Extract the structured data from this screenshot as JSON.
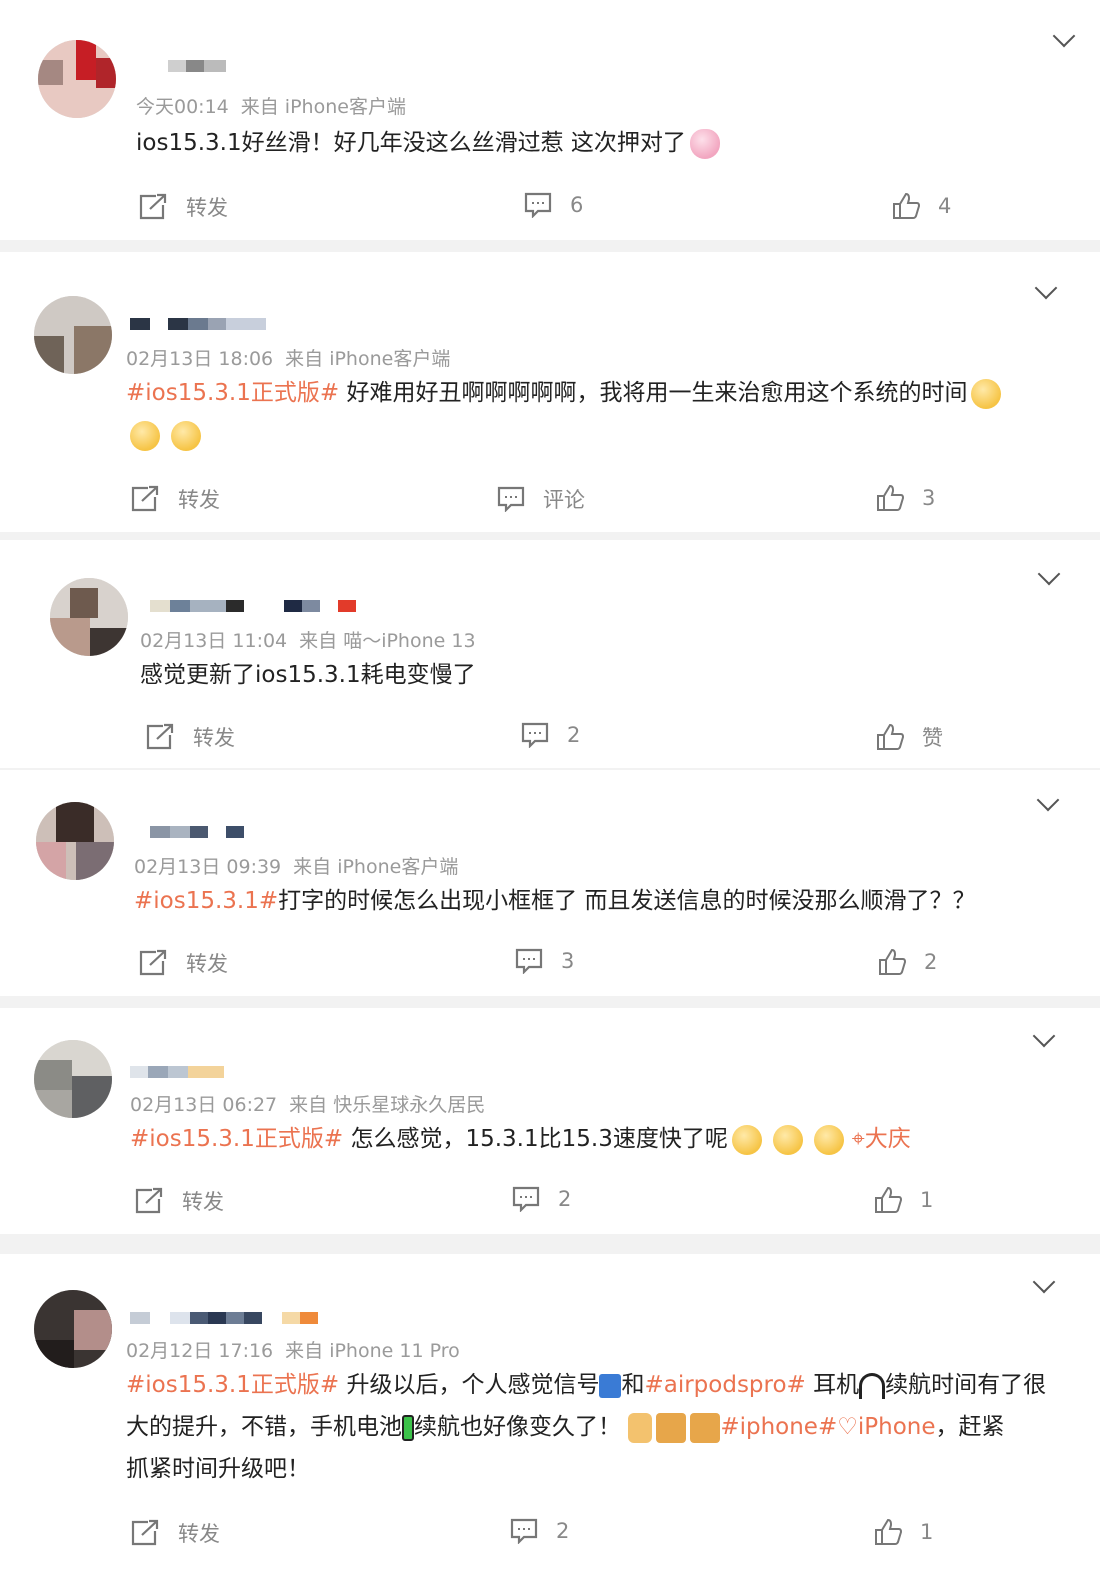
{
  "actions": {
    "repost": "转发",
    "comment": "评论",
    "like": "赞"
  },
  "posts": [
    {
      "time": "今天00:14",
      "source": "来自 iPhone客户端",
      "text": "ios15.3.1好丝滑！好几年没这么丝滑过惹 这次押对了",
      "comments": "6",
      "likes": "4"
    },
    {
      "time": "02月13日 18:06",
      "source": "来自 iPhone客户端",
      "topic": "#ios15.3.1正式版#",
      "text": " 好难用好丑啊啊啊啊啊，我将用一生来治愈用这个系统的时间",
      "comments": "评论",
      "likes": "3"
    },
    {
      "time": "02月13日 11:04",
      "source": "来自 喵～iPhone 13",
      "text": "感觉更新了ios15.3.1耗电变慢了",
      "comments": "2",
      "likes": "赞"
    },
    {
      "time": "02月13日 09:39",
      "source": "来自 iPhone客户端",
      "topic": "#ios15.3.1#",
      "text": "打字的时候怎么出现小框框了 而且发送信息的时候没那么顺滑了？？",
      "comments": "3",
      "likes": "2"
    },
    {
      "time": "02月13日 06:27",
      "source": "来自 快乐星球永久居民",
      "topic": "#ios15.3.1正式版#",
      "text": " 怎么感觉，15.3.1比15.3速度快了呢",
      "location": "大庆",
      "comments": "2",
      "likes": "1"
    },
    {
      "time": "02月12日 17:16",
      "source": "来自 iPhone 11 Pro",
      "topic": "#ios15.3.1正式版#",
      "text_a": " 升级以后，个人感觉信号",
      "text_b": "和",
      "topic2": "#airpodspro#",
      "text_c": " 耳机",
      "text_d": "续航时间有了很",
      "line2_a": "大的提升，不错，手机电池",
      "line2_b": "续航也好像变久了！",
      "topic3": "#iphone#",
      "topic4": "iPhone",
      "line2_c": "，赶紧",
      "line3": "抓紧时间升级吧！",
      "comments": "2",
      "likes": "1"
    }
  ]
}
